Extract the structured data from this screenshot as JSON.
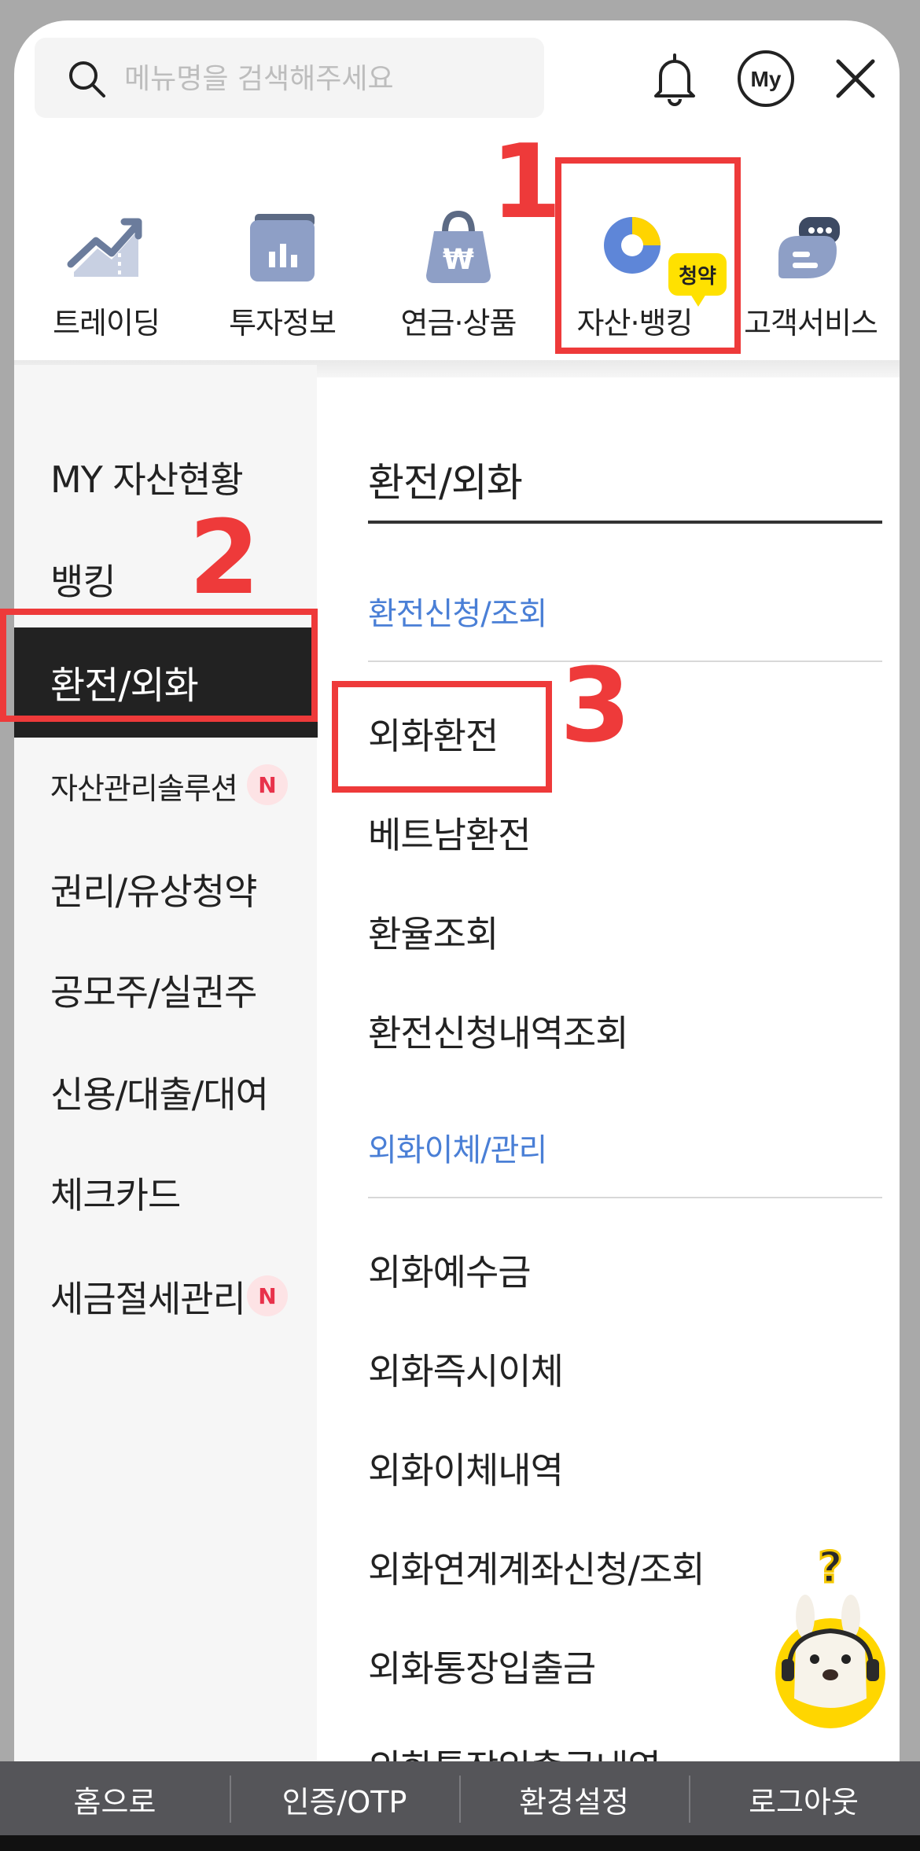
{
  "search": {
    "placeholder": "메뉴명을 검색해주세요"
  },
  "header": {
    "bell_icon": "bell-icon",
    "my_label": "My",
    "close_icon": "close-icon"
  },
  "categories": [
    {
      "label": "트레이딩",
      "icon": "chart-up-icon"
    },
    {
      "label": "투자정보",
      "icon": "report-icon"
    },
    {
      "label": "연금·상품",
      "icon": "money-bag-icon"
    },
    {
      "label": "자산·뱅킹",
      "icon": "pie-chart-icon",
      "badge": "청약"
    },
    {
      "label": "고객서비스",
      "icon": "chat-bubble-icon"
    }
  ],
  "left_menu": {
    "items": [
      {
        "label": "MY 자산현황"
      },
      {
        "label": "뱅킹"
      },
      {
        "label": "환전/외화",
        "active": true
      },
      {
        "label": "자산관리솔루션",
        "badge": "N"
      },
      {
        "label": "권리/유상청약"
      },
      {
        "label": "공모주/실권주"
      },
      {
        "label": "신용/대출/대여"
      },
      {
        "label": "체크카드"
      },
      {
        "label": "세금절세관리",
        "badge": "N"
      }
    ]
  },
  "right_menu": {
    "title": "환전/외화",
    "sections": [
      {
        "heading": "환전신청/조회",
        "items": [
          "외화환전",
          "베트남환전",
          "환율조회",
          "환전신청내역조회"
        ]
      },
      {
        "heading": "외화이체/관리",
        "items": [
          "외화예수금",
          "외화즉시이체",
          "외화이체내역",
          "외화연계계좌신청/조회",
          "외화통장입출금",
          "외화통장입출금내역"
        ]
      }
    ]
  },
  "annotations": [
    "1",
    "2",
    "3"
  ],
  "bottom_bar": [
    "홈으로",
    "인증/OTP",
    "환경설정",
    "로그아웃"
  ],
  "colors": {
    "accent_blue": "#4a7fd6",
    "annotation_red": "#ee3a3a",
    "badge_yellow": "#ffe100",
    "active_bg": "#222222"
  }
}
